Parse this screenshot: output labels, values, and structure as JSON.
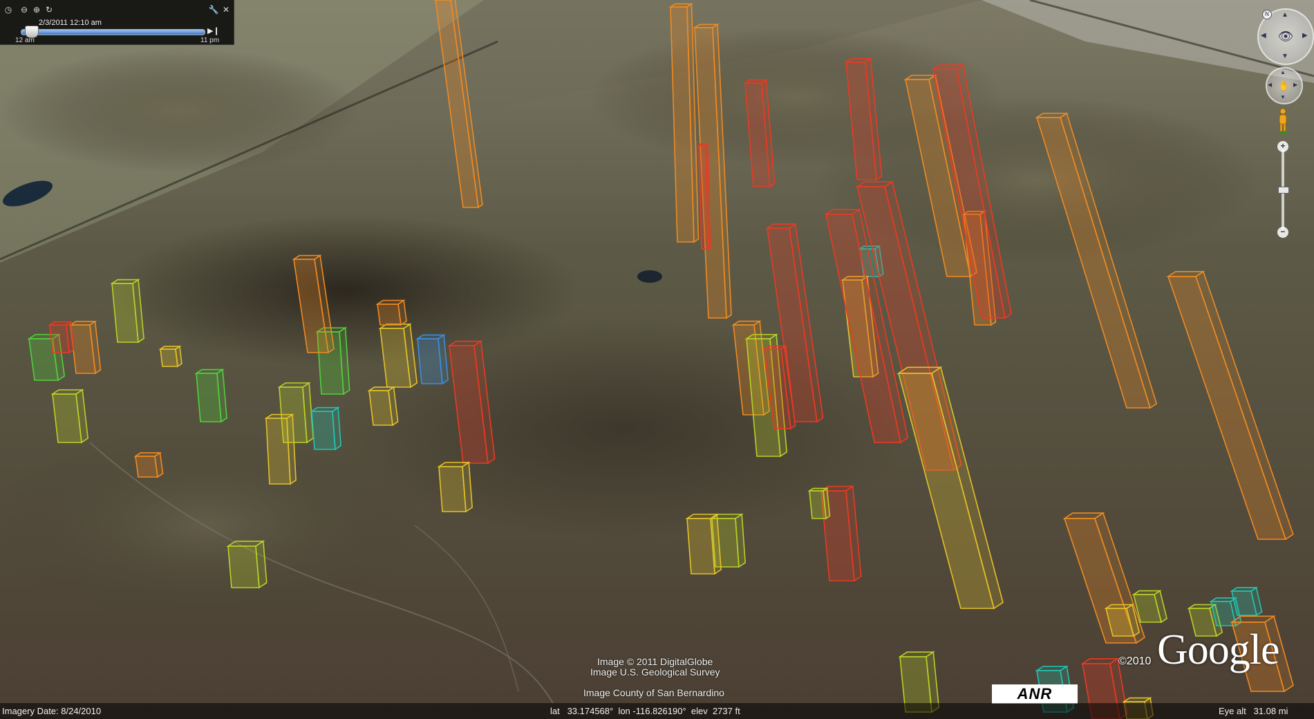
{
  "time_slider": {
    "current_time": "2/3/2011  12:10 am",
    "start_label": "12 am",
    "end_label": "11 pm",
    "icons": [
      "clock-icon",
      "zoom-out-icon",
      "zoom-in-icon",
      "refresh-icon",
      "wrench-icon",
      "close-icon"
    ]
  },
  "status_bar": {
    "imagery_date": "Imagery Date: 8/24/2010",
    "coordinates": "lat   33.174568°  lon -116.826190°  elev  2737 ft",
    "eye_alt": "Eye alt   31.08 mi"
  },
  "attribution": {
    "line1": "Image © 2011 DigitalGlobe",
    "line2": "Image U.S. Geological Survey",
    "line3": "Image County of San Bernardino",
    "copyright": "©2010",
    "logo": "Google",
    "partner_logo": "ANR"
  },
  "navigation": {
    "zoom_level": 0.5,
    "controls": [
      "look-control",
      "move-control",
      "street-view-pegman",
      "zoom-slider"
    ]
  },
  "colors": {
    "green": "#4fd23a",
    "yellow_green": "#b8d226",
    "yellow": "#e2c22a",
    "orange": "#ef8a22",
    "red": "#ea3a24",
    "cyan": "#1fc6b4",
    "blue": "#3a8fe0"
  }
}
